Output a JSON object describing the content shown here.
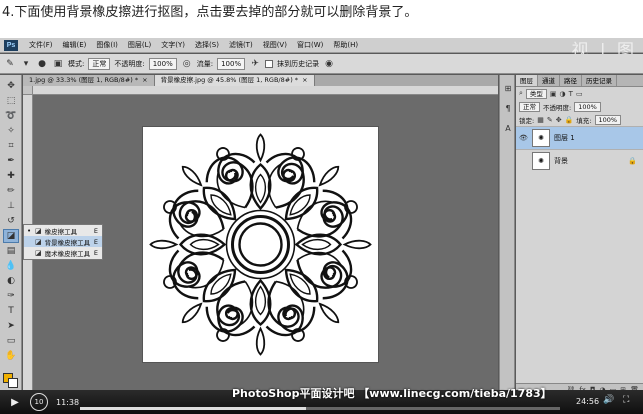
{
  "caption": "4.下面使用背景橡皮擦进行抠图，点击要去掉的部分就可以删除背景了。",
  "watermark": "视 | 图",
  "app": {
    "logo": "Ps",
    "menus": [
      "文件(F)",
      "编辑(E)",
      "图像(I)",
      "图层(L)",
      "文字(Y)",
      "选择(S)",
      "滤镜(T)",
      "视图(V)",
      "窗口(W)",
      "帮助(H)"
    ]
  },
  "options": {
    "mode_label": "模式:",
    "mode_value": "正常",
    "opacity_label": "不透明度:",
    "opacity_value": "100%",
    "flow_label": "流量:",
    "flow_value": "100%",
    "history_label": "抹到历史记录"
  },
  "tabs": [
    {
      "label": "1.jpg @ 33.3% (图层 1, RGB/8#) *"
    },
    {
      "label": "背景橡皮擦.jpg @ 45.8% (图层 1, RGB/8#) *"
    }
  ],
  "flyout": {
    "items": [
      {
        "label": "橡皮擦工具",
        "key": "E",
        "selected": false
      },
      {
        "label": "背景橡皮擦工具",
        "key": "E",
        "selected": true
      },
      {
        "label": "魔术橡皮擦工具",
        "key": "E",
        "selected": false
      }
    ]
  },
  "layers_panel": {
    "tabs": [
      "图层",
      "通道",
      "路径",
      "历史记录"
    ],
    "filter_label": "类型",
    "blend_mode": "正常",
    "opacity_label": "不透明度:",
    "opacity_value": "100%",
    "lock_label": "锁定:",
    "fill_label": "填充:",
    "fill_value": "100%",
    "layers": [
      {
        "name": "图层 1",
        "selected": true
      },
      {
        "name": "背景",
        "selected": false
      }
    ]
  },
  "player": {
    "current_time": "11:38",
    "duration": "24:56",
    "progress": 0.47,
    "brand_text": "PhotoShop平面设计吧 【www.linecg.com/tieba/1783】"
  },
  "colors": {
    "foreground": "#f0b000",
    "background": "#ffffff",
    "selection": "#a8c7e8"
  }
}
